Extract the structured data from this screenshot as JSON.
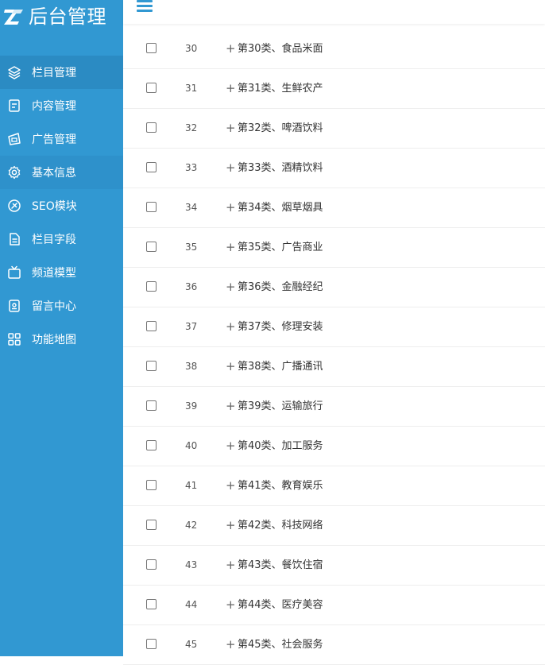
{
  "sidebar": {
    "logo_text": "后台管理",
    "items": [
      {
        "label": "栏目管理",
        "icon": "layers-icon",
        "state": "active"
      },
      {
        "label": "内容管理",
        "icon": "document-icon",
        "state": ""
      },
      {
        "label": "广告管理",
        "icon": "ad-icon",
        "state": ""
      },
      {
        "label": "基本信息",
        "icon": "gear-icon",
        "state": "hl"
      },
      {
        "label": "SEO模块",
        "icon": "seo-icon",
        "state": ""
      },
      {
        "label": "栏目字段",
        "icon": "file-icon",
        "state": ""
      },
      {
        "label": "频道模型",
        "icon": "tv-icon",
        "state": ""
      },
      {
        "label": "留言中心",
        "icon": "message-icon",
        "state": ""
      },
      {
        "label": "功能地图",
        "icon": "grid-icon",
        "state": ""
      }
    ]
  },
  "table": {
    "expand_symbol": "+",
    "rows": [
      {
        "id": "30",
        "name": "第30类、食品米面"
      },
      {
        "id": "31",
        "name": "第31类、生鲜农产"
      },
      {
        "id": "32",
        "name": "第32类、啤酒饮料"
      },
      {
        "id": "33",
        "name": "第33类、酒精饮料"
      },
      {
        "id": "34",
        "name": "第34类、烟草烟具"
      },
      {
        "id": "35",
        "name": "第35类、广告商业"
      },
      {
        "id": "36",
        "name": "第36类、金融经纪"
      },
      {
        "id": "37",
        "name": "第37类、修理安装"
      },
      {
        "id": "38",
        "name": "第38类、广播通讯"
      },
      {
        "id": "39",
        "name": "第39类、运输旅行"
      },
      {
        "id": "40",
        "name": "第40类、加工服务"
      },
      {
        "id": "41",
        "name": "第41类、教育娱乐"
      },
      {
        "id": "42",
        "name": "第42类、科技网络"
      },
      {
        "id": "43",
        "name": "第43类、餐饮住宿"
      },
      {
        "id": "44",
        "name": "第44类、医疗美容"
      },
      {
        "id": "45",
        "name": "第45类、社会服务"
      }
    ]
  },
  "colors": {
    "sidebar": "#3198d2",
    "accent": "#3198d2"
  }
}
